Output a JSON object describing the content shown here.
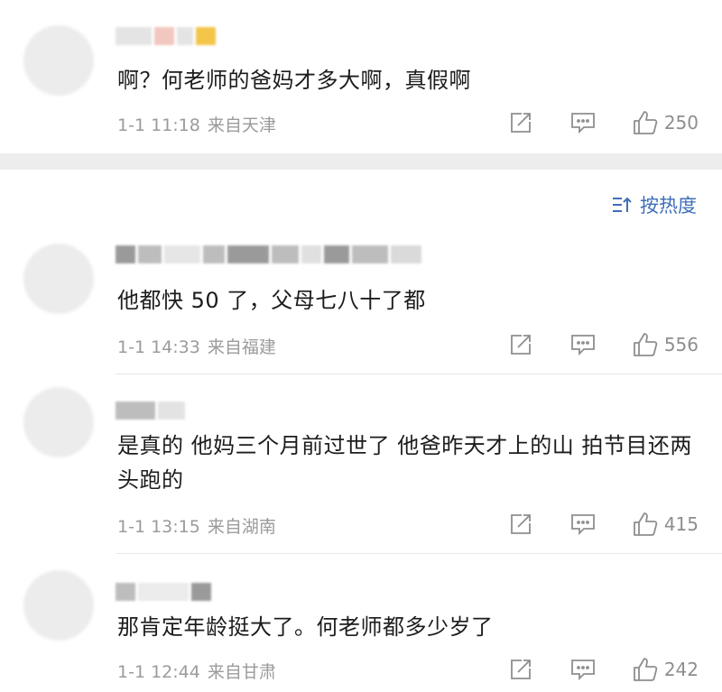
{
  "sort": {
    "label": "按热度"
  },
  "comments": [
    {
      "text": "啊？何老师的爸妈才多大啊，真假啊",
      "time": "1-1 11:18",
      "location": "来自天津",
      "likes": "250"
    },
    {
      "text": "他都快 50 了，父母七八十了都",
      "time": "1-1 14:33",
      "location": "来自福建",
      "likes": "556"
    },
    {
      "text": "是真的 他妈三个月前过世了 他爸昨天才上的山 拍节目还两头跑的",
      "time": "1-1 13:15",
      "location": "来自湖南",
      "likes": "415"
    },
    {
      "text": "那肯定年龄挺大了。何老师都多少岁了",
      "time": "1-1 12:44",
      "location": "来自甘肃",
      "likes": "242"
    }
  ],
  "icons": {
    "repost": "repost-icon",
    "reply": "comment-icon",
    "like": "thumbs-up-icon",
    "sort": "sort-icon"
  },
  "colors": {
    "link": "#3e6fb8",
    "meta": "#9b9b9b",
    "separator": "#ededed"
  }
}
